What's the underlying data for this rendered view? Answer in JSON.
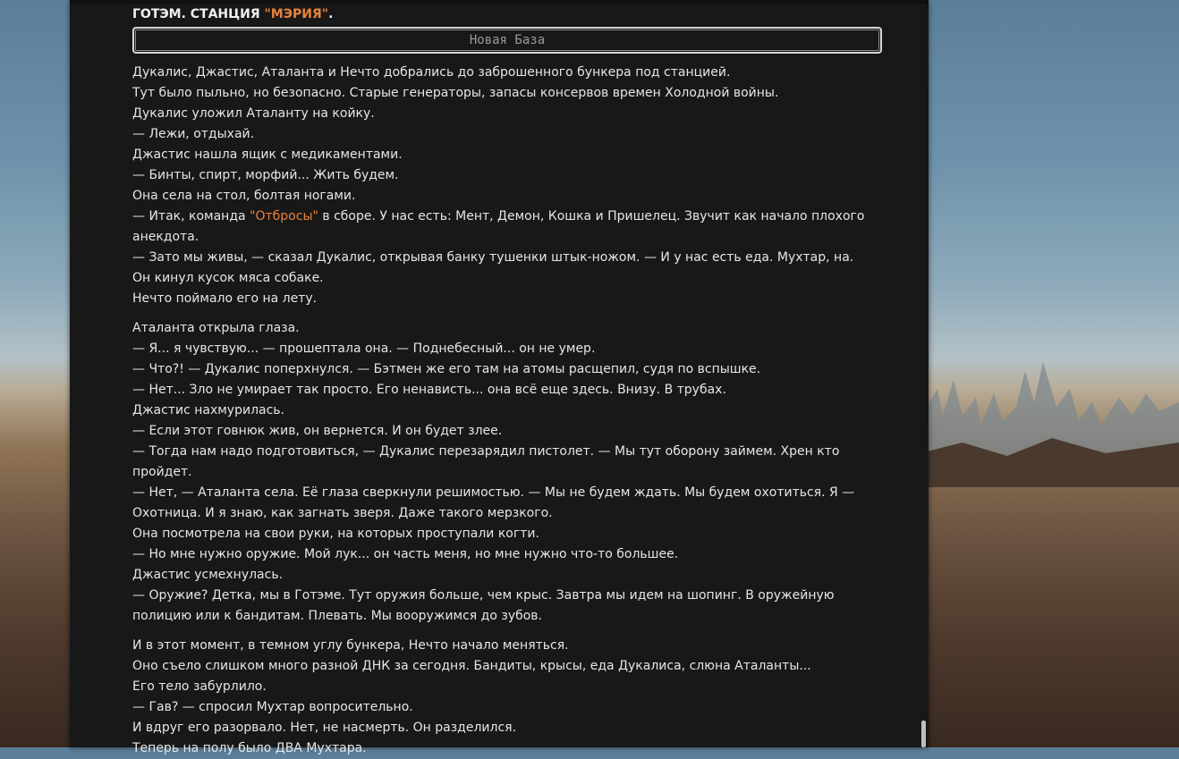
{
  "header": {
    "station_prefix": "ГОТЭМ. СТАНЦИЯ ",
    "station_name": "\"МЭРИЯ\"",
    "station_suffix": "."
  },
  "base_label": "Новая База",
  "colors": {
    "accent": "#e8833a",
    "panel": "#181818",
    "text": "#e6e6e6"
  },
  "paragraphs": [
    [
      "Дукалис, Джастис, Аталанта и Нечто добрались до заброшенного бункера под станцией.",
      "Тут было пыльно, но безопасно. Старые генераторы, запасы консервов времен Холодной войны.",
      "Дукалис уложил Аталанту на койку.",
      "— Лежи, отдыхай.",
      "Джастис нашла ящик с медикаментами.",
      "— Бинты, спирт, морфий... Жить будем.",
      "Она села на стол, болтая ногами."
    ],
    [
      "Аталанта открыла глаза.",
      "— Я... я чувствую... — прошептала она. — Поднебесный... он не умер.",
      "— Что?! — Дукалис поперхнулся. — Бэтмен же его там на атомы расщепил, судя по вспышке.",
      "— Нет... Зло не умирает так просто. Его ненависть... она всё еще здесь. Внизу. В трубах.",
      "Джастис нахмурилась.",
      "— Если этот говнюк жив, он вернется. И он будет злее.",
      "— Тогда нам надо подготовиться, — Дукалис перезарядил пистолет. — Мы тут оборону займем. Хрен кто пройдет.",
      "— Нет, — Аталанта села. Её глаза сверкнули решимостью. — Мы не будем ждать. Мы будем охотиться. Я — Охотница. И я знаю, как загнать зверя. Даже такого мерзкого.",
      "Она посмотрела на свои руки, на которых проступали когти.",
      "— Но мне нужно оружие. Мой лук... он часть меня, но мне нужно что-то большее.",
      "Джастис усмехнулась.",
      "— Оружие? Детка, мы в Готэме. Тут оружия больше, чем крыс. Завтра мы идем на шопинг. В оружейную полицию или к бандитам. Плевать. Мы вооружимся до зубов."
    ],
    [
      "И в этот момент, в темном углу бункера, Нечто начало меняться.",
      "Оно съело слишком много разной ДНК за сегодня. Бандиты, крысы, еда Дукалиса, слюна Аталанты...",
      "Его тело забурлило.",
      "— Гав? — спросил Мухтар вопросительно.",
      "И вдруг его разорвало. Нет, не насмерть. Он разделился.",
      "Теперь на полу было ДВА Мухтара."
    ]
  ],
  "team_line": {
    "before": "— Итак, команда ",
    "name": "\"Отбросы\"",
    "after": " в сборе. У нас есть: Мент, Демон, Кошка и Пришелец. Звучит как начало плохого анекдота."
  },
  "after_team": [
    "— Зато мы живы, — сказал Дукалис, открывая банку тушенки штык-ножом. — И у нас есть еда. Мухтар, на.",
    "Он кинул кусок мяса собаке.",
    "Нечто поймало его на лету."
  ]
}
